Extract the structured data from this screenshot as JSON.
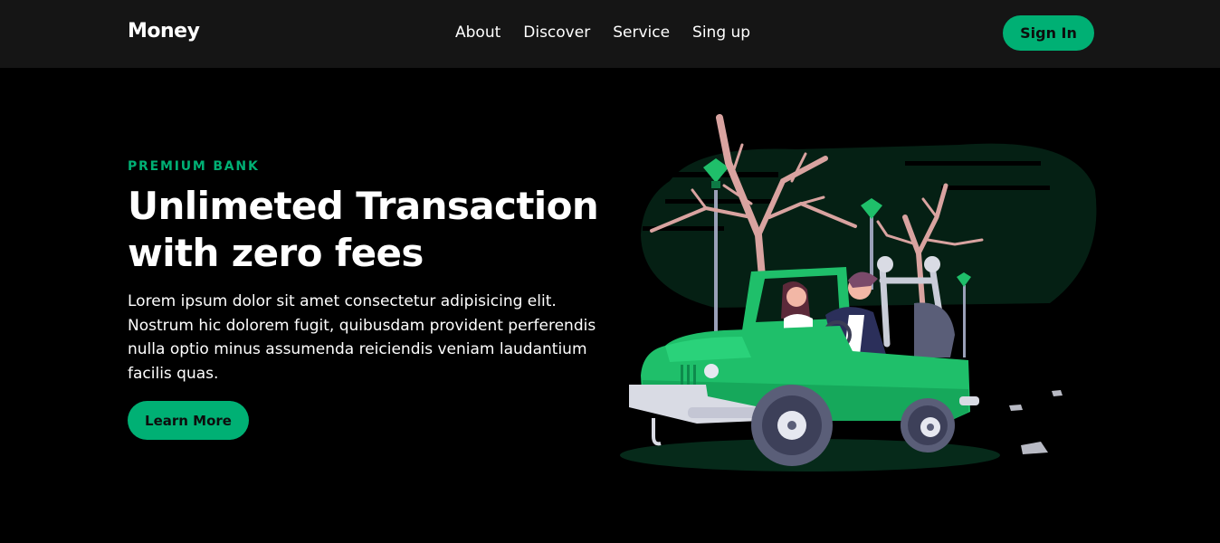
{
  "brand": {
    "name": "Money"
  },
  "nav": {
    "links": [
      "About",
      "Discover",
      "Service",
      "Sing up"
    ],
    "signin_label": "Sign In"
  },
  "hero": {
    "eyebrow": "PREMIUM BANK",
    "headline_line1": "Unlimeted Transaction",
    "headline_line2": "with zero fees",
    "body": "Lorem ipsum dolor sit amet consectetur adipisicing elit. Nostrum hic dolorem fugit, quibusdam provident perferendis nulla optio minus assumenda reiciendis veniam laudantium facilis quas.",
    "cta_label": "Learn More"
  },
  "illustration": {
    "subject": "couple-driving-green-jeep-illustration"
  },
  "colors": {
    "accent": "#00b074",
    "navbar_bg": "#151515",
    "page_bg": "#000000",
    "jeep_green": "#1fbf6a",
    "tree": "#d9a3a0"
  }
}
